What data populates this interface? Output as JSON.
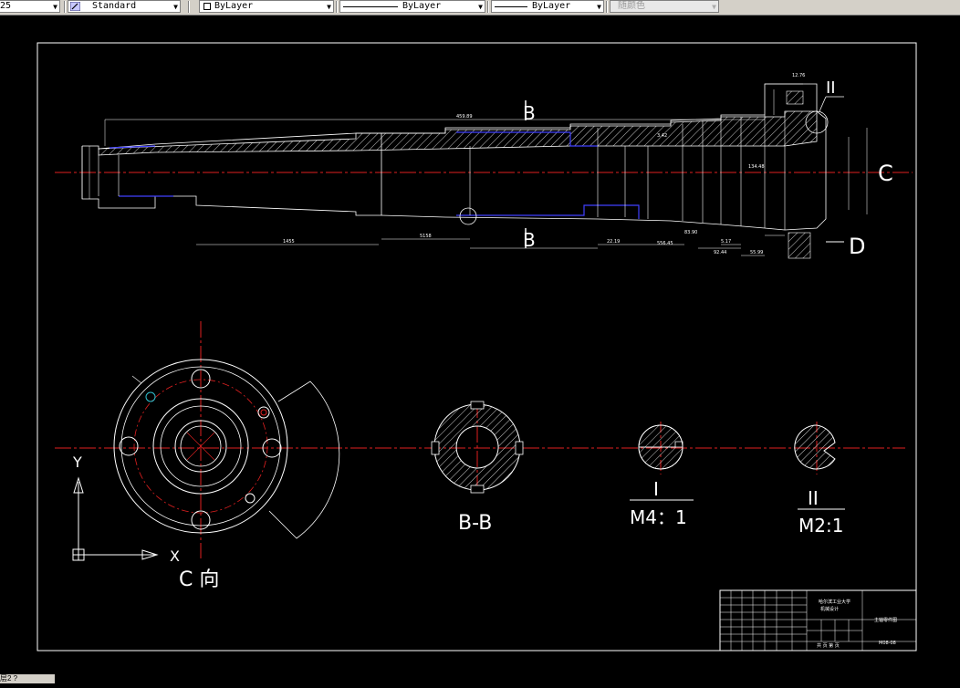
{
  "toolbar": {
    "layer_index": "25",
    "text_style": "Standard",
    "color_layer": "ByLayer",
    "linetype": "ByLayer",
    "lineweight": "ByLayer",
    "plot_style": "随颜色"
  },
  "drawing": {
    "labels": {
      "section_b_top": "B",
      "section_b_bottom": "B",
      "detail_ii": "II",
      "arrow_c": "C",
      "arrow_d": "D",
      "view_c": "C 向",
      "section_bb": "B-B",
      "detail_i": "I",
      "scale_i": "M4：1",
      "detail_ii_title": "II",
      "scale_ii": "M2:1",
      "axis_y": "Y",
      "axis_x": "X"
    },
    "dims": {
      "overall_length": "459.89",
      "d1": "1455",
      "d2": "5158",
      "d3": "22.19",
      "d4": "556.45",
      "d5": "83.90",
      "d6": "5.17",
      "d7": "92.44",
      "d8": "55.99",
      "d9": "134.48",
      "d10": "3.42",
      "d11": "12.76"
    },
    "title_block": {
      "school": "哈尔滨工业大学",
      "sub": "机械设计",
      "name": "主轴零件图",
      "code": "M08-08",
      "footer": "共 页 第 页"
    }
  },
  "status": {
    "text": "层2 ?"
  }
}
